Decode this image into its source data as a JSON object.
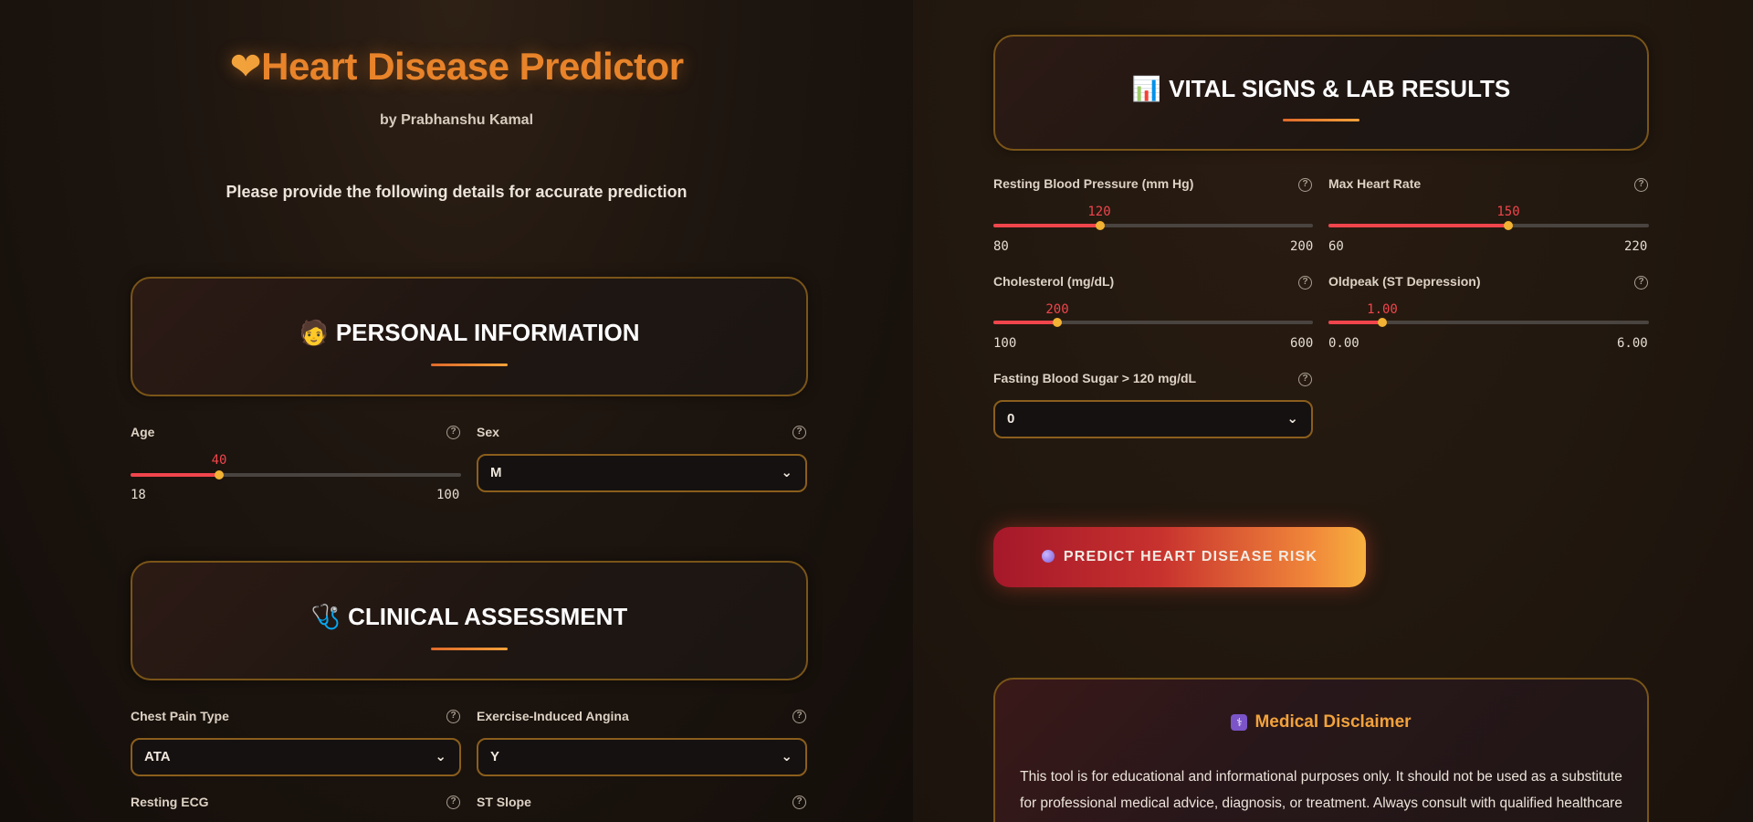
{
  "header": {
    "title_icon": "heart-icon",
    "title": "Heart Disease Predictor",
    "byline": "by Prabhanshu Kamal",
    "intro": "Please provide the following details for accurate prediction"
  },
  "sections": {
    "personal": {
      "icon": "person-icon",
      "title": "PERSONAL INFORMATION"
    },
    "clinical": {
      "icon": "stethoscope-icon",
      "title": "CLINICAL ASSESSMENT"
    },
    "vitals": {
      "icon": "bar-chart-icon",
      "title": "VITAL SIGNS & LAB RESULTS"
    }
  },
  "fields": {
    "age": {
      "label": "Age",
      "value": "40",
      "min": "18",
      "max": "100",
      "fraction": 0.268
    },
    "sex": {
      "label": "Sex",
      "value": "M"
    },
    "chest_pain": {
      "label": "Chest Pain Type",
      "value": "ATA"
    },
    "exercise_angina": {
      "label": "Exercise-Induced Angina",
      "value": "Y"
    },
    "resting_ecg": {
      "label": "Resting ECG"
    },
    "st_slope": {
      "label": "ST Slope"
    },
    "resting_bp": {
      "label": "Resting Blood Pressure (mm Hg)",
      "value": "120",
      "min": "80",
      "max": "200",
      "fraction": 0.333
    },
    "max_hr": {
      "label": "Max Heart Rate",
      "value": "150",
      "min": "60",
      "max": "220",
      "fraction": 0.5625
    },
    "cholesterol": {
      "label": "Cholesterol (mg/dL)",
      "value": "200",
      "min": "100",
      "max": "600",
      "fraction": 0.2
    },
    "oldpeak": {
      "label": "Oldpeak (ST Depression)",
      "value": "1.00",
      "min": "0.00",
      "max": "6.00",
      "fraction": 0.1667
    },
    "fasting_bs": {
      "label": "Fasting Blood Sugar > 120 mg/dL",
      "value": "0"
    }
  },
  "actions": {
    "predict_label": "PREDICT HEART DISEASE RISK",
    "predict_icon": "crystal-ball-icon"
  },
  "disclaimer": {
    "icon": "medical-icon",
    "title": "Medical Disclaimer",
    "text": "This tool is for educational and informational purposes only. It should not be used as a substitute for professional medical advice, diagnosis, or treatment. Always consult with qualified healthcare professionals for accurate medical assessment and personalized treatment recommendations."
  },
  "colors": {
    "accent_orange": "#e8832a",
    "slider_red": "#f0454c",
    "thumb_yellow": "#f2b233",
    "border_gold": "#8b5e1c"
  }
}
